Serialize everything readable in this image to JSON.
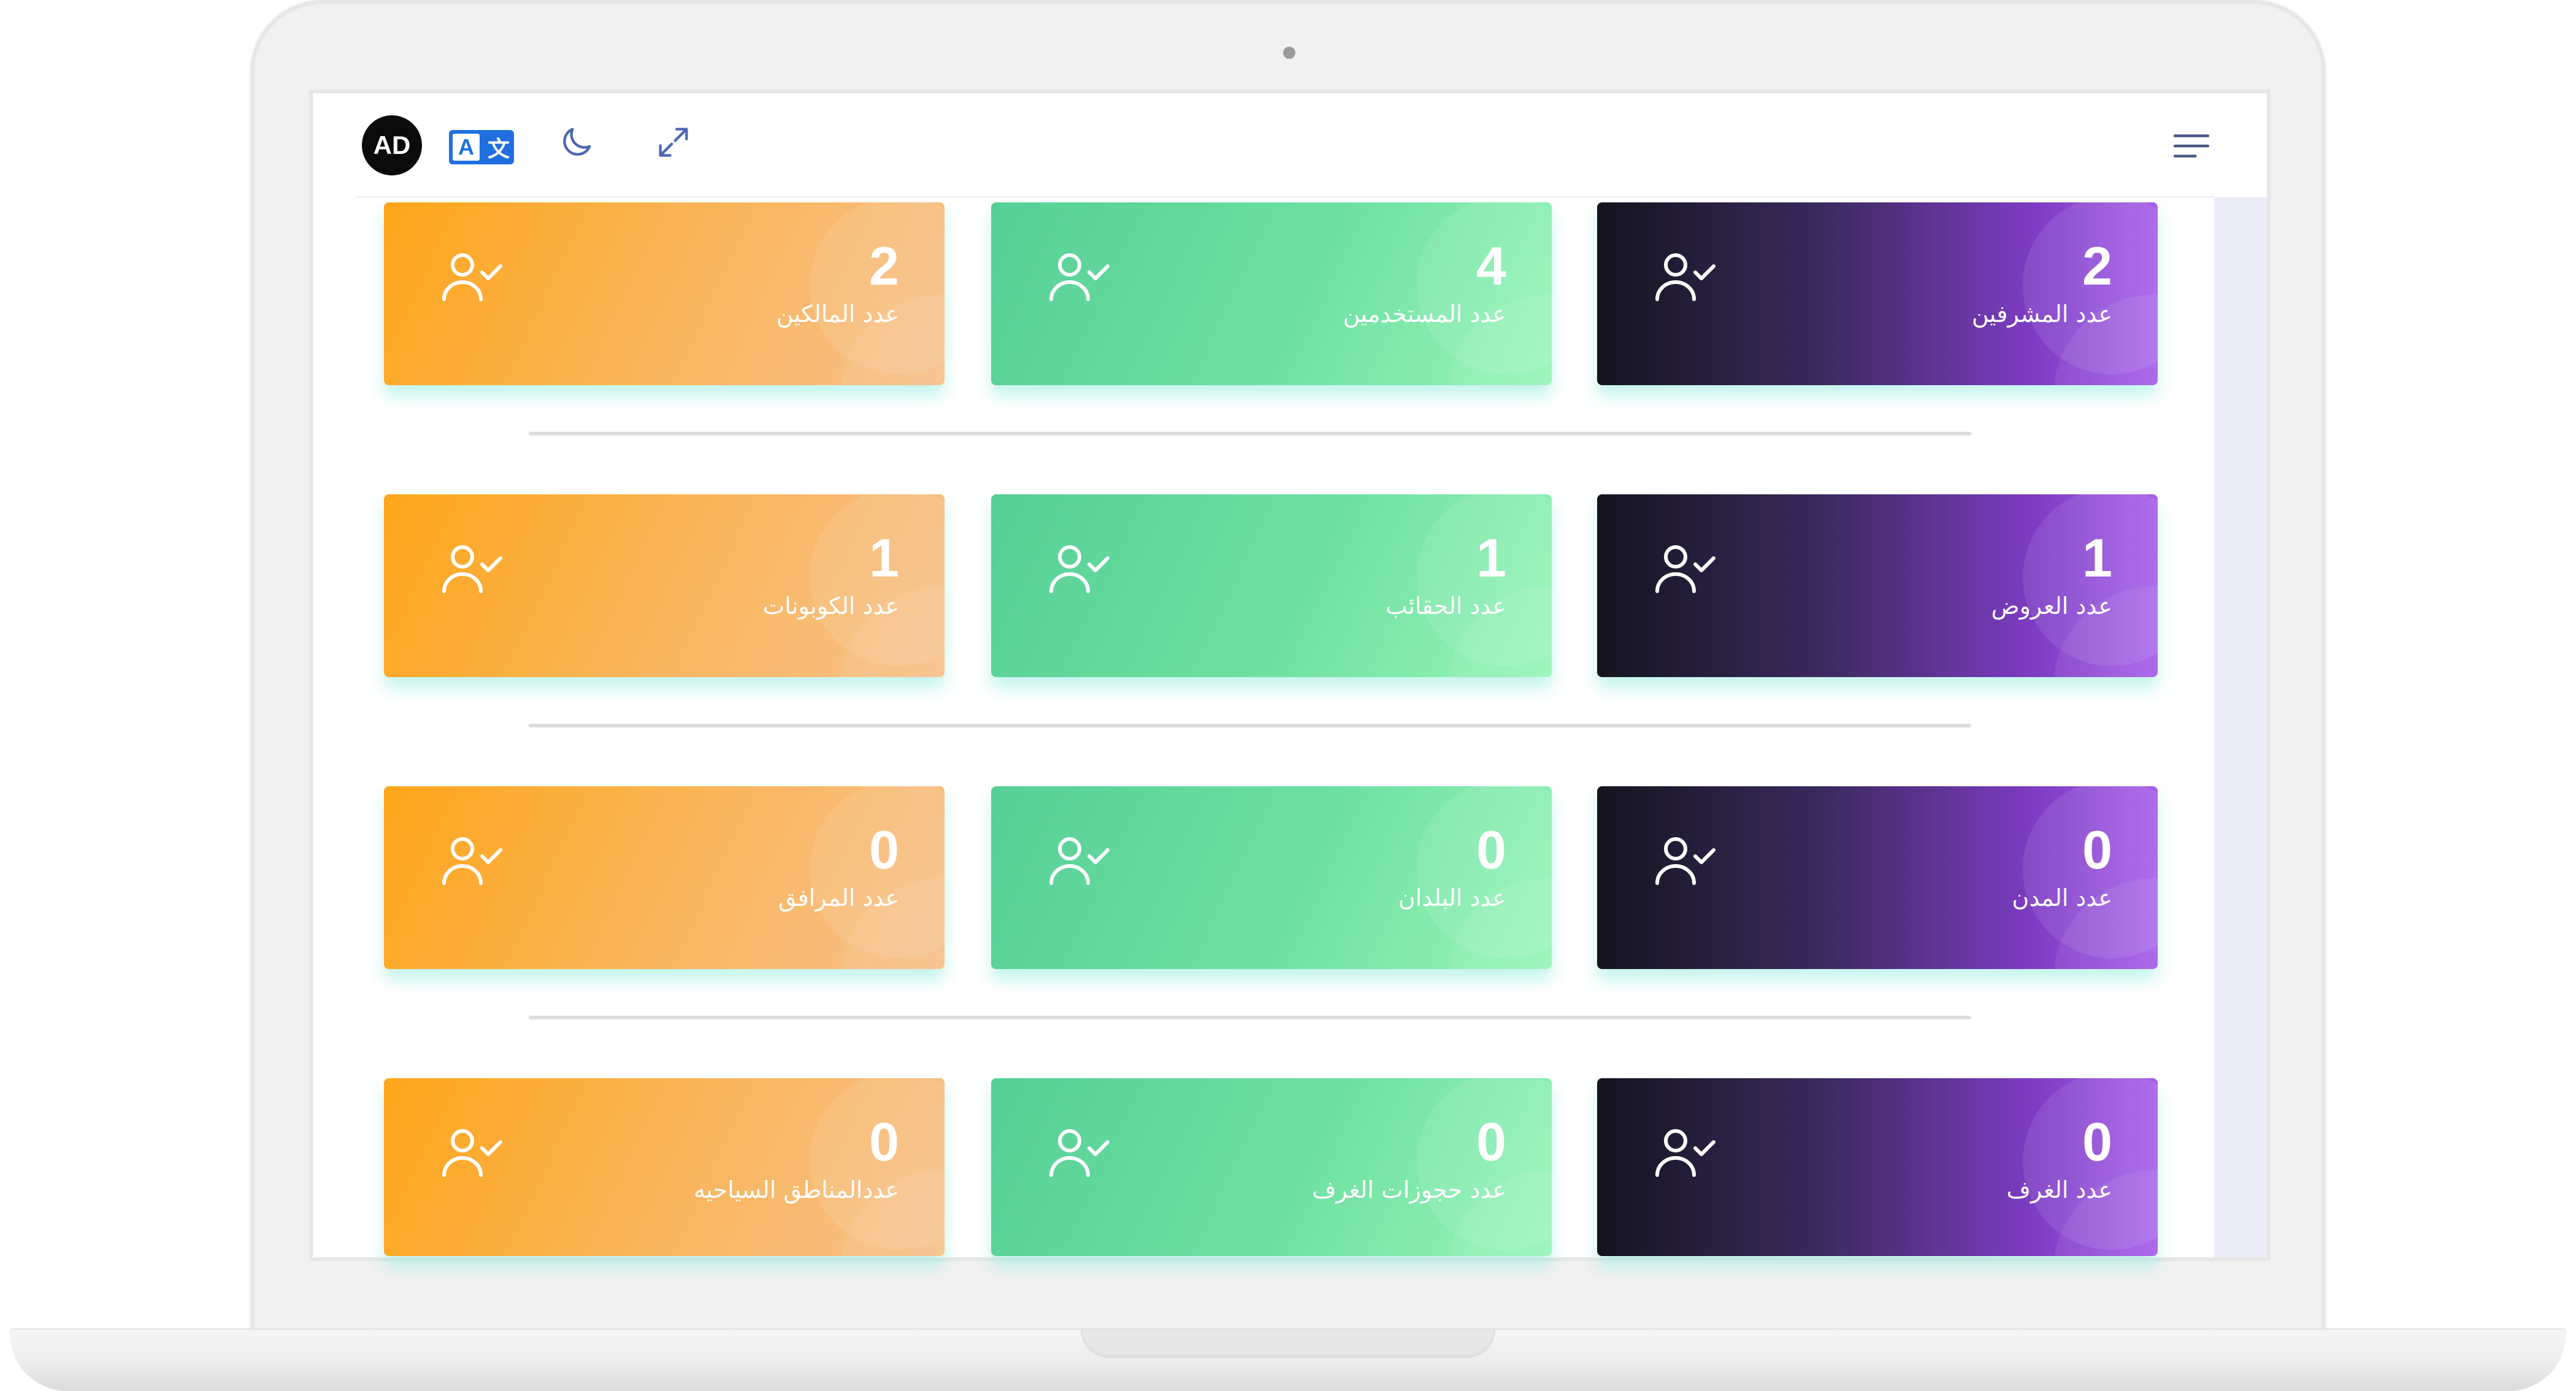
{
  "header": {
    "avatar_initials": "AD",
    "translate_left": "A",
    "translate_right": "文",
    "icons": [
      "translate-icon",
      "moon-icon",
      "expand-icon",
      "menu-icon"
    ]
  },
  "colors": {
    "orange": "#fea61a",
    "green": "#56cf96",
    "purple": "#7e3cc4",
    "dark": "#14141e"
  },
  "stats": [
    {
      "label": "عدد المشرفين",
      "count": "2",
      "color": "purple"
    },
    {
      "label": "عدد المستخدمين",
      "count": "4",
      "color": "green"
    },
    {
      "label": "عدد المالكين",
      "count": "2",
      "color": "orange"
    },
    {
      "label": "عدد العروض",
      "count": "1",
      "color": "purple"
    },
    {
      "label": "عدد الحقائب",
      "count": "1",
      "color": "green"
    },
    {
      "label": "عدد الكوبونات",
      "count": "1",
      "color": "orange"
    },
    {
      "label": "عدد المدن",
      "count": "0",
      "color": "purple"
    },
    {
      "label": "عدد البلدان",
      "count": "0",
      "color": "green"
    },
    {
      "label": "عدد المرافق",
      "count": "0",
      "color": "orange"
    },
    {
      "label": "عدد الغرف",
      "count": "0",
      "color": "purple"
    },
    {
      "label": "عدد حجوزات الغرف",
      "count": "0",
      "color": "green"
    },
    {
      "label": "عددالمناطق السياحيه",
      "count": "0",
      "color": "orange"
    }
  ]
}
